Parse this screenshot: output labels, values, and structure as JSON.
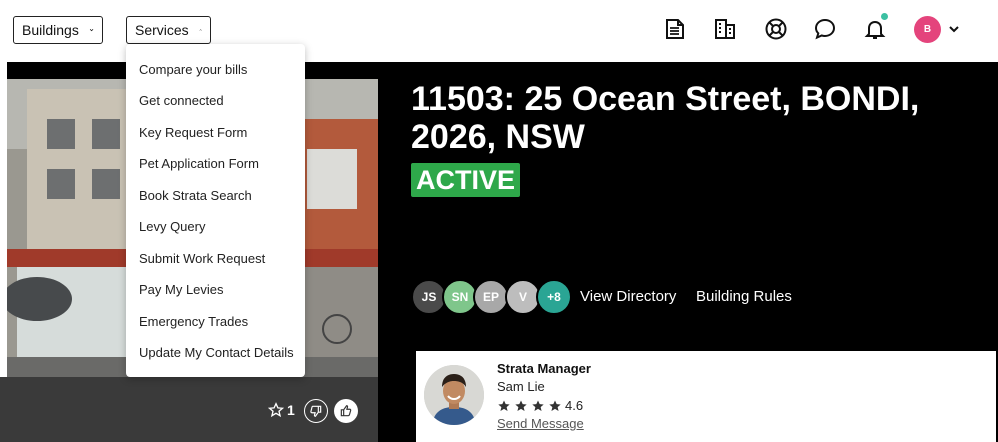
{
  "nav": {
    "buildings_label": "Buildings",
    "services_label": "Services"
  },
  "header_icons": [
    "document-icon",
    "building-icon",
    "help-icon",
    "chat-icon",
    "bell-icon"
  ],
  "user": {
    "initial": "B",
    "color": "#e4447c"
  },
  "services_menu": [
    "Compare your bills",
    "Get connected",
    "Key Request Form",
    "Pet Application Form",
    "Book Strata Search",
    "Levy Query",
    "Submit Work Request",
    "Pay My Levies",
    "Emergency Trades",
    "Update My Contact Details"
  ],
  "building": {
    "title": "11503: 25 Ocean Street, BONDI, 2026, NSW",
    "status": "ACTIVE",
    "status_color": "#2ea84a",
    "star_count": "1"
  },
  "people": [
    {
      "initials": "JS",
      "color": "#4a4a4a"
    },
    {
      "initials": "SN",
      "color": "#7fc68b"
    },
    {
      "initials": "EP",
      "color": "#a8a8a8"
    },
    {
      "initials": "V",
      "color": "#bdbdbd"
    },
    {
      "initials": "+8",
      "color": "#2aa594"
    }
  ],
  "links": {
    "directory": "View Directory",
    "rules": "Building Rules"
  },
  "manager": {
    "role": "Strata Manager",
    "name": "Sam Lie",
    "rating": "4.6",
    "stars": 4,
    "message_label": "Send Message"
  }
}
